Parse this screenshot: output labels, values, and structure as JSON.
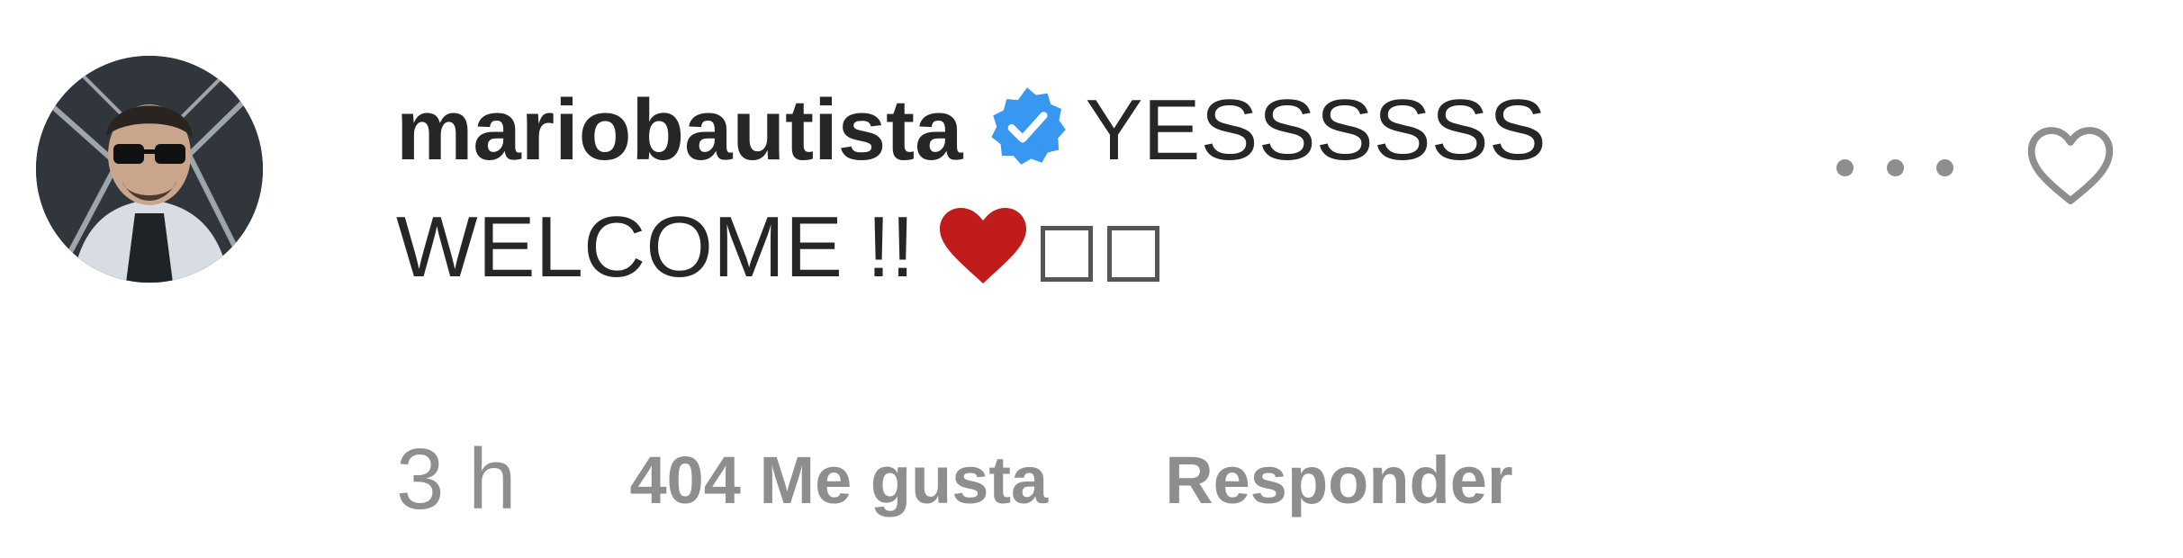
{
  "comment": {
    "username": "mariobautista",
    "text": "YESSSSSS WELCOME !!",
    "verified": true,
    "verified_icon": "verified-badge-icon",
    "emoji": [
      "red-heart-emoji",
      "missing-glyph",
      "missing-glyph"
    ],
    "timestamp": "3 h",
    "likes": "404 Me gusta",
    "reply_label": "Responder"
  },
  "icons": {
    "options": "more-options-icon",
    "like": "heart-outline-icon"
  },
  "colors": {
    "text": "#262626",
    "secondary": "#8e8e8e",
    "verified_blue": "#3897f0",
    "heart_red": "#c01c1c"
  }
}
